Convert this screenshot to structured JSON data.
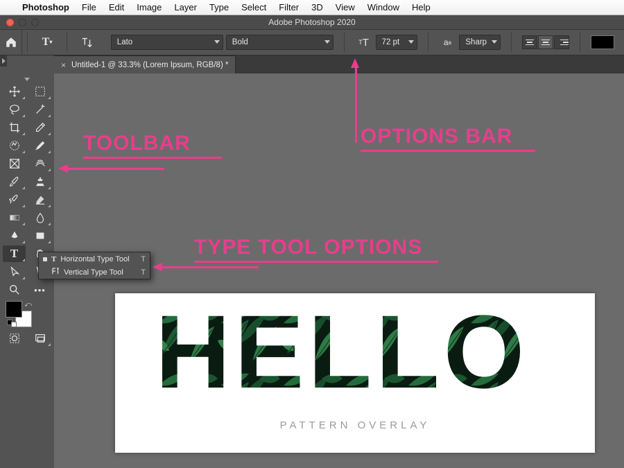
{
  "macmenu": {
    "app": "Photoshop",
    "items": [
      "File",
      "Edit",
      "Image",
      "Layer",
      "Type",
      "Select",
      "Filter",
      "3D",
      "View",
      "Window",
      "Help"
    ]
  },
  "window": {
    "title": "Adobe Photoshop 2020"
  },
  "options_bar": {
    "font_family": "Lato",
    "font_weight": "Bold",
    "font_size": "72 pt",
    "antialias": "Sharp"
  },
  "document_tab": {
    "label": "Untitled-1 @ 33.3% (Lorem Ipsum, RGB/8) *"
  },
  "flyout": {
    "items": [
      {
        "label": "Horizontal Type Tool",
        "shortcut": "T",
        "active": true
      },
      {
        "label": "Vertical Type Tool",
        "shortcut": "T",
        "active": false
      }
    ]
  },
  "artboard": {
    "headline": "HELLO",
    "subtitle": "PATTERN OVERLAY"
  },
  "annotations": {
    "toolbar": "TOOLBAR",
    "optionsbar": "OPTIONS BAR",
    "typetool": "TYPE TOOL OPTIONS"
  },
  "colors": {
    "accent": "#e83e8c",
    "ui_bg": "#535353",
    "canvas_bg": "#6b6b6b"
  },
  "tools": {
    "left_col": [
      "move",
      "lasso",
      "crop",
      "spot-heal",
      "frame",
      "brush",
      "history-brush",
      "gradient",
      "pen",
      "type",
      "path-select",
      "zoom"
    ],
    "right_col": [
      "marquee",
      "magic-wand",
      "eyedropper",
      "eraser-brush",
      "smudge",
      "clone-stamp",
      "eraser",
      "blur",
      "rectangle",
      "hand",
      "direct-select",
      "more"
    ]
  }
}
